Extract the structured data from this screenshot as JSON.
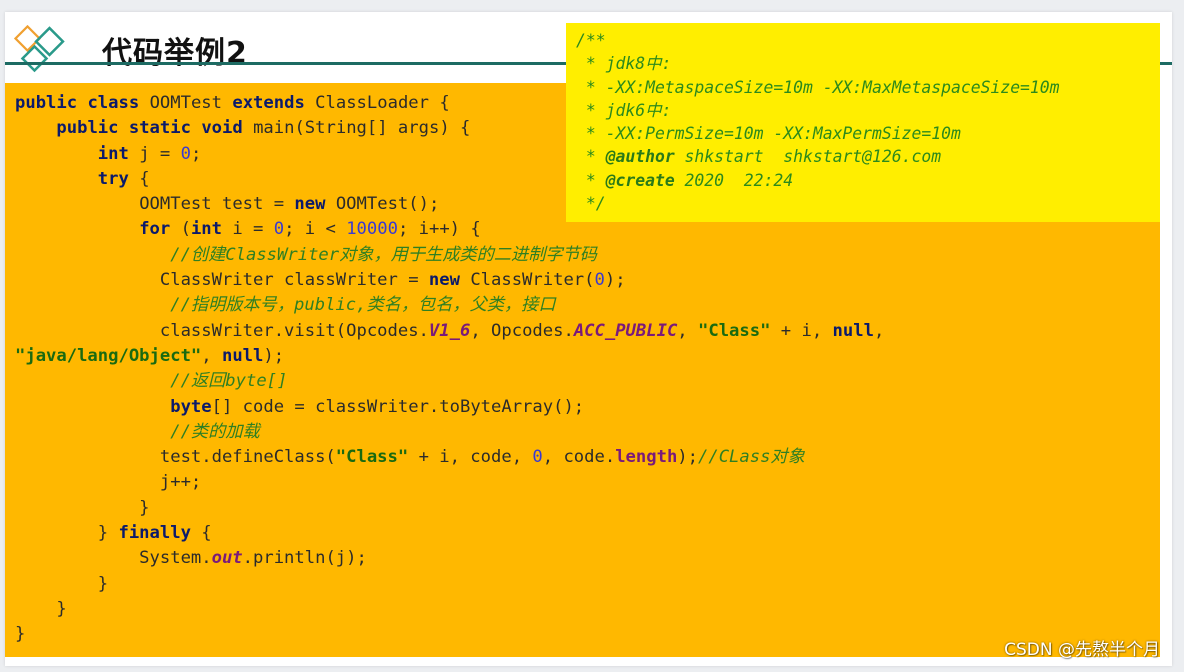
{
  "slide": {
    "title": "代码举例2",
    "logo_icon": "diamond-logo-icon",
    "colors": {
      "rule": "#1d6b63",
      "code_bg": "#ffb800",
      "comment_bg": "#ffee00",
      "logo_orange": "#f0a030",
      "logo_teal": "#2a9a8a"
    }
  },
  "comment_box": {
    "lines": [
      "/**",
      " * jdk8中:",
      " * -XX:MetaspaceSize=10m -XX:MaxMetaspaceSize=10m",
      " * jdk6中:",
      " * -XX:PermSize=10m -XX:MaxPermSize=10m",
      " * @author shkstart  shkstart@126.com",
      " * @create 2020  22:24",
      " */"
    ],
    "author_tag": "@author",
    "author_value": " shkstart  shkstart@126.com",
    "create_tag": "@create",
    "create_value": " 2020  22:24"
  },
  "code": {
    "t": {
      "public": "public",
      "class": "class",
      "OOMTest": "OOMTest",
      "extends": "extends",
      "ClassLoader": "ClassLoader",
      "static": "static",
      "void": "void",
      "int": "int",
      "try": "try",
      "new": "new",
      "for": "for",
      "null": "null",
      "byte": "byte",
      "finally": "finally",
      "out": "out",
      "length": "length",
      "V1_6": "V1_6",
      "ACC_PUBLIC": "ACC_PUBLIC",
      "zero": "0",
      "tenk": "10000",
      "str_class": "\"Class\"",
      "str_object": "\"java/lang/Object\""
    },
    "comments": {
      "c1": "//创建ClassWriter对象，用于生成类的二进制字节码",
      "c2": "//指明版本号，public,类名，包名，父类，接口",
      "c3": "//返回byte[]",
      "c4": "//类的加载",
      "c5": "//CLass对象"
    }
  },
  "watermark": "CSDN @先熬半个月"
}
